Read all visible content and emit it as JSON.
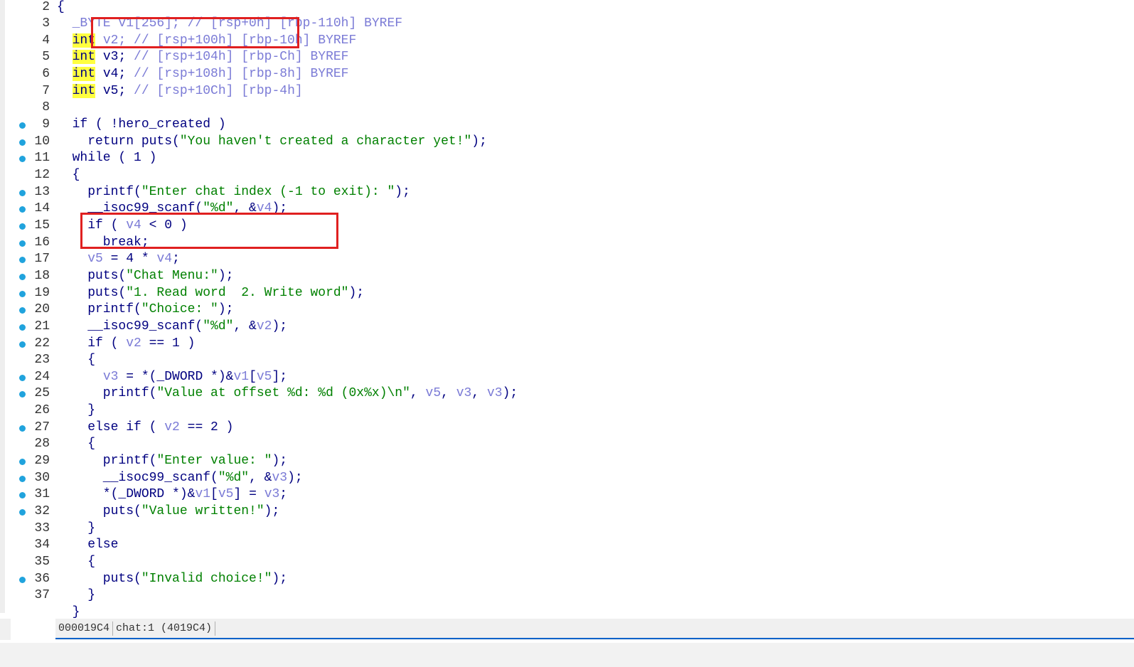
{
  "editor": {
    "lines": [
      {
        "num": "2",
        "bp": false,
        "tokens": [
          {
            "t": "{",
            "c": "code"
          }
        ]
      },
      {
        "num": "3",
        "bp": false,
        "tokens": [
          {
            "t": "  _BYTE v1[256]; // [rsp+0h] [rbp-110h] BYREF",
            "c": "com"
          }
        ]
      },
      {
        "num": "4",
        "bp": false,
        "tokens": [
          {
            "t": "  ",
            "c": "code"
          },
          {
            "t": "int",
            "c": "kwhl"
          },
          {
            "t": " v2; // [rsp+100h] [rbp-10h] BYREF",
            "c": "com"
          }
        ]
      },
      {
        "num": "5",
        "bp": false,
        "tokens": [
          {
            "t": "  ",
            "c": "code"
          },
          {
            "t": "int",
            "c": "kwhl"
          },
          {
            "t": " v3; ",
            "c": "code"
          },
          {
            "t": "// [rsp+104h] [rbp-Ch] BYREF",
            "c": "com"
          }
        ]
      },
      {
        "num": "6",
        "bp": false,
        "tokens": [
          {
            "t": "  ",
            "c": "code"
          },
          {
            "t": "int",
            "c": "kwhl"
          },
          {
            "t": " v4; ",
            "c": "code"
          },
          {
            "t": "// [rsp+108h] [rbp-8h] BYREF",
            "c": "com"
          }
        ]
      },
      {
        "num": "7",
        "bp": false,
        "tokens": [
          {
            "t": "  ",
            "c": "code"
          },
          {
            "t": "int",
            "c": "kwhl"
          },
          {
            "t": " v5; ",
            "c": "code"
          },
          {
            "t": "// [rsp+10Ch] [rbp-4h]",
            "c": "com"
          }
        ]
      },
      {
        "num": "8",
        "bp": false,
        "tokens": []
      },
      {
        "num": "9",
        "bp": true,
        "tokens": [
          {
            "t": "  if ( !hero_created )",
            "c": "code"
          }
        ]
      },
      {
        "num": "10",
        "bp": true,
        "tokens": [
          {
            "t": "    return puts(",
            "c": "code"
          },
          {
            "t": "\"You haven't created a character yet!\"",
            "c": "str"
          },
          {
            "t": ");",
            "c": "code"
          }
        ]
      },
      {
        "num": "11",
        "bp": true,
        "tokens": [
          {
            "t": "  while ( 1 )",
            "c": "code"
          }
        ]
      },
      {
        "num": "12",
        "bp": false,
        "tokens": [
          {
            "t": "  {",
            "c": "code"
          }
        ]
      },
      {
        "num": "13",
        "bp": true,
        "tokens": [
          {
            "t": "    printf(",
            "c": "code"
          },
          {
            "t": "\"Enter chat index (-1 to exit): \"",
            "c": "str"
          },
          {
            "t": ");",
            "c": "code"
          }
        ]
      },
      {
        "num": "14",
        "bp": true,
        "tokens": [
          {
            "t": "    __isoc99_scanf(",
            "c": "code"
          },
          {
            "t": "\"%d\"",
            "c": "str"
          },
          {
            "t": ", &",
            "c": "code"
          },
          {
            "t": "v4",
            "c": "var"
          },
          {
            "t": ");",
            "c": "code"
          }
        ]
      },
      {
        "num": "15",
        "bp": true,
        "tokens": [
          {
            "t": "    if ( ",
            "c": "code"
          },
          {
            "t": "v4",
            "c": "var"
          },
          {
            "t": " < 0 )",
            "c": "code"
          }
        ]
      },
      {
        "num": "16",
        "bp": true,
        "tokens": [
          {
            "t": "      break;",
            "c": "code"
          }
        ]
      },
      {
        "num": "17",
        "bp": true,
        "tokens": [
          {
            "t": "    ",
            "c": "code"
          },
          {
            "t": "v5",
            "c": "var"
          },
          {
            "t": " = 4 * ",
            "c": "code"
          },
          {
            "t": "v4",
            "c": "var"
          },
          {
            "t": ";",
            "c": "code"
          }
        ]
      },
      {
        "num": "18",
        "bp": true,
        "tokens": [
          {
            "t": "    puts(",
            "c": "code"
          },
          {
            "t": "\"Chat Menu:\"",
            "c": "str"
          },
          {
            "t": ");",
            "c": "code"
          }
        ]
      },
      {
        "num": "19",
        "bp": true,
        "tokens": [
          {
            "t": "    puts(",
            "c": "code"
          },
          {
            "t": "\"1. Read word  2. Write word\"",
            "c": "str"
          },
          {
            "t": ");",
            "c": "code"
          }
        ]
      },
      {
        "num": "20",
        "bp": true,
        "tokens": [
          {
            "t": "    printf(",
            "c": "code"
          },
          {
            "t": "\"Choice: \"",
            "c": "str"
          },
          {
            "t": ");",
            "c": "code"
          }
        ]
      },
      {
        "num": "21",
        "bp": true,
        "tokens": [
          {
            "t": "    __isoc99_scanf(",
            "c": "code"
          },
          {
            "t": "\"%d\"",
            "c": "str"
          },
          {
            "t": ", &",
            "c": "code"
          },
          {
            "t": "v2",
            "c": "var"
          },
          {
            "t": ");",
            "c": "code"
          }
        ]
      },
      {
        "num": "22",
        "bp": true,
        "tokens": [
          {
            "t": "    if ( ",
            "c": "code"
          },
          {
            "t": "v2",
            "c": "var"
          },
          {
            "t": " == 1 )",
            "c": "code"
          }
        ]
      },
      {
        "num": "23",
        "bp": false,
        "tokens": [
          {
            "t": "    {",
            "c": "code"
          }
        ]
      },
      {
        "num": "24",
        "bp": true,
        "tokens": [
          {
            "t": "      ",
            "c": "code"
          },
          {
            "t": "v3",
            "c": "var"
          },
          {
            "t": " = *(_DWORD *)&",
            "c": "code"
          },
          {
            "t": "v1",
            "c": "var"
          },
          {
            "t": "[",
            "c": "code"
          },
          {
            "t": "v5",
            "c": "var"
          },
          {
            "t": "];",
            "c": "code"
          }
        ]
      },
      {
        "num": "25",
        "bp": true,
        "tokens": [
          {
            "t": "      printf(",
            "c": "code"
          },
          {
            "t": "\"Value at offset %d: %d (0x%x)\\n\"",
            "c": "str"
          },
          {
            "t": ", ",
            "c": "code"
          },
          {
            "t": "v5",
            "c": "var"
          },
          {
            "t": ", ",
            "c": "code"
          },
          {
            "t": "v3",
            "c": "var"
          },
          {
            "t": ", ",
            "c": "code"
          },
          {
            "t": "v3",
            "c": "var"
          },
          {
            "t": ");",
            "c": "code"
          }
        ]
      },
      {
        "num": "26",
        "bp": false,
        "tokens": [
          {
            "t": "    }",
            "c": "code"
          }
        ]
      },
      {
        "num": "27",
        "bp": true,
        "tokens": [
          {
            "t": "    else if ( ",
            "c": "code"
          },
          {
            "t": "v2",
            "c": "var"
          },
          {
            "t": " == 2 )",
            "c": "code"
          }
        ]
      },
      {
        "num": "28",
        "bp": false,
        "tokens": [
          {
            "t": "    {",
            "c": "code"
          }
        ]
      },
      {
        "num": "29",
        "bp": true,
        "tokens": [
          {
            "t": "      printf(",
            "c": "code"
          },
          {
            "t": "\"Enter value: \"",
            "c": "str"
          },
          {
            "t": ");",
            "c": "code"
          }
        ]
      },
      {
        "num": "30",
        "bp": true,
        "tokens": [
          {
            "t": "      __isoc99_scanf(",
            "c": "code"
          },
          {
            "t": "\"%d\"",
            "c": "str"
          },
          {
            "t": ", &",
            "c": "code"
          },
          {
            "t": "v3",
            "c": "var"
          },
          {
            "t": ");",
            "c": "code"
          }
        ]
      },
      {
        "num": "31",
        "bp": true,
        "tokens": [
          {
            "t": "      *(_DWORD *)&",
            "c": "code"
          },
          {
            "t": "v1",
            "c": "var"
          },
          {
            "t": "[",
            "c": "code"
          },
          {
            "t": "v5",
            "c": "var"
          },
          {
            "t": "] = ",
            "c": "code"
          },
          {
            "t": "v3",
            "c": "var"
          },
          {
            "t": ";",
            "c": "code"
          }
        ]
      },
      {
        "num": "32",
        "bp": true,
        "tokens": [
          {
            "t": "      puts(",
            "c": "code"
          },
          {
            "t": "\"Value written!\"",
            "c": "str"
          },
          {
            "t": ");",
            "c": "code"
          }
        ]
      },
      {
        "num": "33",
        "bp": false,
        "tokens": [
          {
            "t": "    }",
            "c": "code"
          }
        ]
      },
      {
        "num": "34",
        "bp": false,
        "tokens": [
          {
            "t": "    else",
            "c": "code"
          }
        ]
      },
      {
        "num": "35",
        "bp": false,
        "tokens": [
          {
            "t": "    {",
            "c": "code"
          }
        ]
      },
      {
        "num": "36",
        "bp": true,
        "tokens": [
          {
            "t": "      puts(",
            "c": "code"
          },
          {
            "t": "\"Invalid choice!\"",
            "c": "str"
          },
          {
            "t": ");",
            "c": "code"
          }
        ]
      },
      {
        "num": "37",
        "bp": false,
        "tokens": [
          {
            "t": "    }",
            "c": "code"
          }
        ]
      },
      {
        "num": "",
        "bp": false,
        "tokens": [
          {
            "t": "  }",
            "c": "code"
          }
        ]
      }
    ]
  },
  "status_bar": {
    "offset": "000019C4",
    "location": "chat:1 (4019C4)"
  },
  "colors": {
    "breakpoint": "#20a3dd",
    "keyword_highlight": "#ffff40",
    "annotation_box": "#e02020",
    "string": "#008000",
    "code": "#000080",
    "variable": "#7b7bd6"
  }
}
